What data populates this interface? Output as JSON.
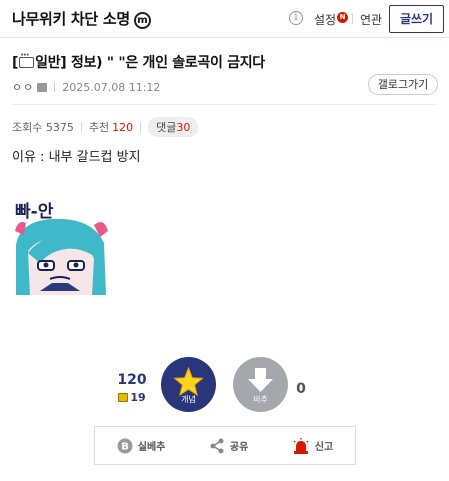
{
  "header": {
    "gallery_title": "나무위키 차단 소명",
    "minor_badge": "m",
    "info_icon": "i",
    "settings_label": "설정",
    "settings_badge": "N",
    "related_label": "연관",
    "write_button": "글쓰기"
  },
  "post": {
    "title_prefix": "[",
    "title_category": "일반] 정보) \" \"은 개인 솔로곡이 금지다",
    "nickname": "ㅇㅇ",
    "date": "2025.07.08 11:12",
    "gallery_link": "갤로그가기",
    "views_label": "조회수",
    "views": "5375",
    "recommend_label": "추천",
    "recommend": "120",
    "comments_label": "댓글",
    "comments": "30",
    "body": "이유 : 내부 갈드컵 방지",
    "sticker_text": "빠-안"
  },
  "votes": {
    "up_count": "120",
    "fix_count": "19",
    "up_label": "개념",
    "down_label": "비추",
    "down_count": "0"
  },
  "actions": {
    "silbe_label": "실베추",
    "share_label": "공유",
    "report_label": "신고"
  },
  "colors": {
    "brand": "#29367c",
    "accent_red": "#d31900",
    "downvote_gray": "#a6a6ad"
  },
  "icons": [
    "minor-gallery-icon",
    "info-icon",
    "chat-icon",
    "star-icon",
    "arrow-down-icon",
    "share-icon",
    "siren-icon",
    "best-icon"
  ]
}
